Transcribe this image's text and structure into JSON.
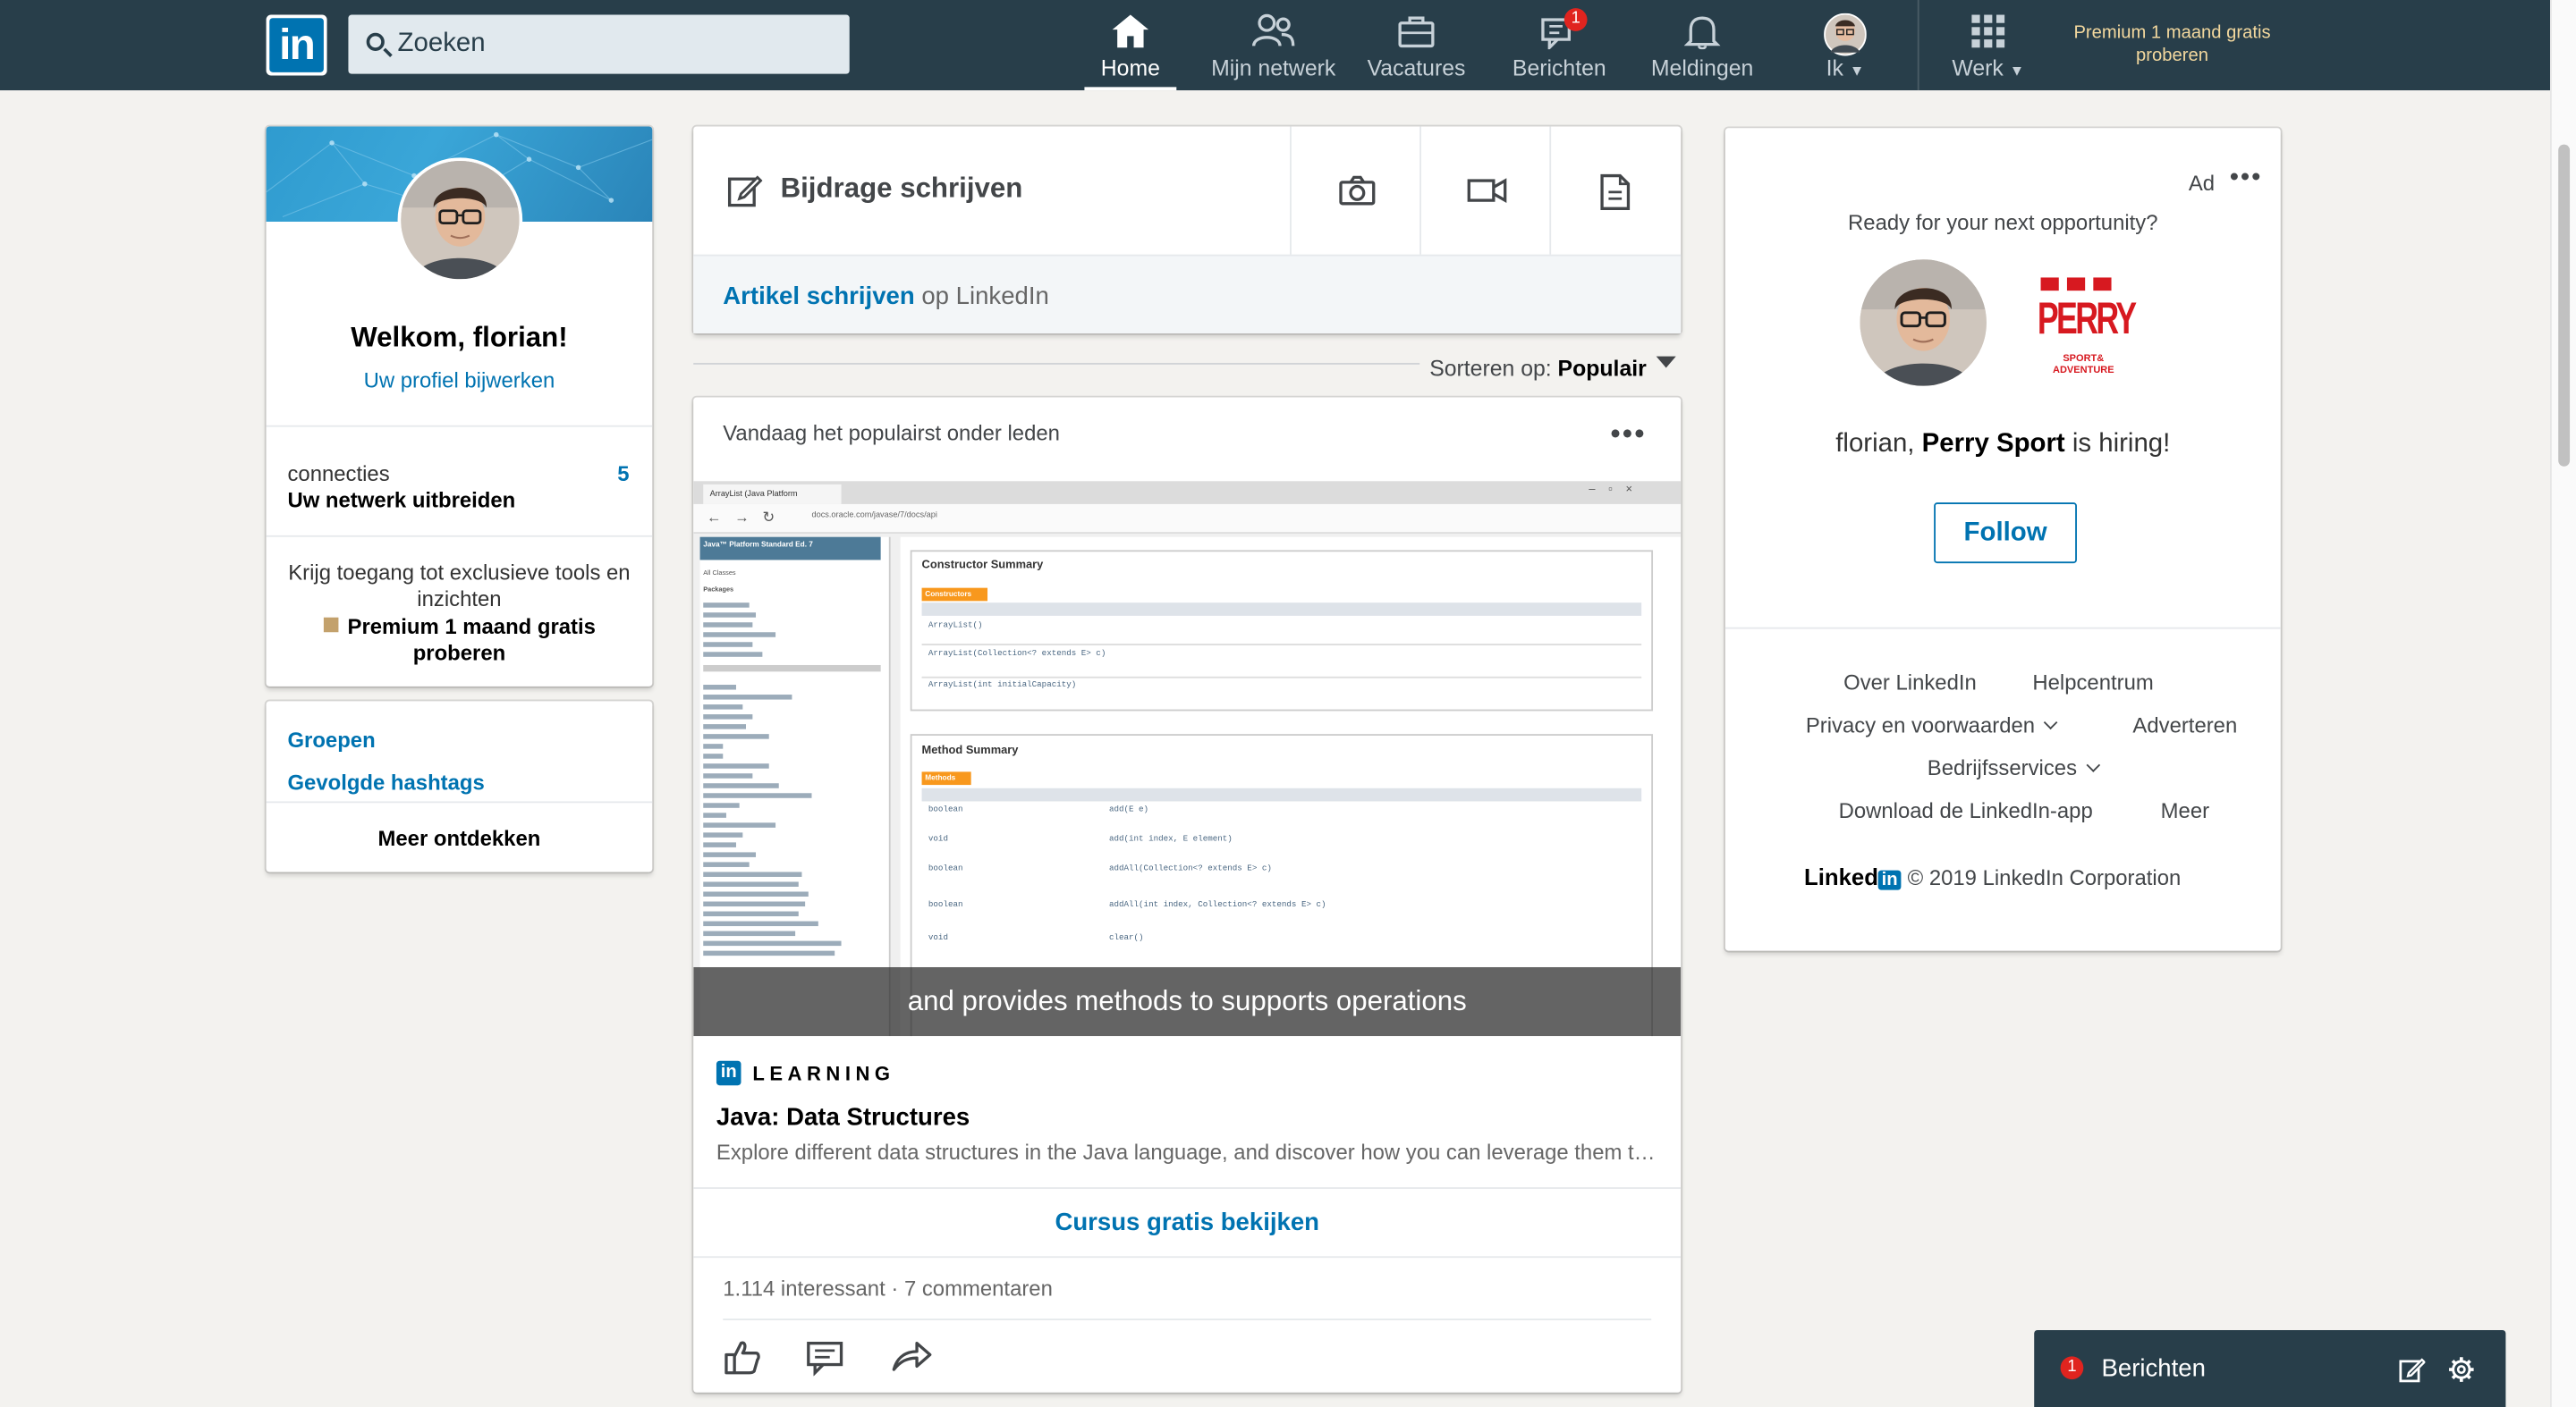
{
  "header": {
    "logo_text": "in",
    "search_placeholder": "Zoeken",
    "nav": [
      {
        "label": "Home",
        "icon": "home-icon"
      },
      {
        "label": "Mijn netwerk",
        "icon": "people-icon"
      },
      {
        "label": "Vacatures",
        "icon": "briefcase-icon"
      },
      {
        "label": "Berichten",
        "icon": "messages-icon",
        "badge": "1"
      },
      {
        "label": "Meldingen",
        "icon": "bell-icon"
      },
      {
        "label": "Ik",
        "icon": "avatar"
      },
      {
        "label": "Werk",
        "icon": "grid-icon"
      }
    ],
    "premium_cta": "Premium 1 maand gratis proberen"
  },
  "profile": {
    "welcome": "Welkom, florian!",
    "update_link": "Uw profiel bijwerken",
    "connections_label": "connecties",
    "connections_sub": "Uw netwerk uitbreiden",
    "connections_count": "5",
    "premium_text": "Krijg toegang tot exclusieve tools en inzichten",
    "premium_cta": "Premium 1 maand gratis proberen"
  },
  "side_links": {
    "groups": "Groepen",
    "hashtags": "Gevolgde hashtags",
    "discover": "Meer ontdekken"
  },
  "share": {
    "write": "Bijdrage schrijven",
    "article_link": "Artikel schrijven",
    "article_suffix": " op LinkedIn"
  },
  "sort": {
    "label": "Sorteren op: ",
    "value": "Populair"
  },
  "feed": {
    "header": "Vandaag het populairst onder leden",
    "video": {
      "tab_title": "ArrayList (Java Platform",
      "url": "docs.oracle.com/javase/7/docs/api",
      "left_head": "Java™ Platform Standard Ed. 7",
      "all_classes": "All Classes",
      "packages": "Packages",
      "constructor_summary": "Constructor Summary",
      "constructors_tag": "Constructors",
      "method_summary": "Method Summary",
      "methods_tag": "Methods",
      "caption": "and provides methods to supports operations"
    },
    "learning_label": "LEARNING",
    "course_title": "Java: Data Structures",
    "course_desc": "Explore different data structures in the Java language, and discover how you can leverage them to write better code.",
    "course_cta": "Cursus gratis bekijken",
    "social_counts": "1.114 interessant · 7 commentaren"
  },
  "ad": {
    "label": "Ad",
    "question": "Ready for your next opportunity?",
    "company_logo_text": "PERRY",
    "company_logo_sub": "SPORT& ADVENTURE",
    "hiring_prefix": "florian, ",
    "hiring_company": "Perry Sport",
    "hiring_suffix": " is hiring!",
    "follow": "Follow"
  },
  "footer": {
    "links": [
      "Over LinkedIn",
      "Helpcentrum",
      "Privacy en voorwaarden",
      "Adverteren",
      "Bedrijfsservices",
      "Download de LinkedIn-app",
      "Meer"
    ],
    "brand_word": "Linked",
    "brand_box": "in",
    "copyright": "© 2019 LinkedIn Corporation"
  },
  "messaging": {
    "badge": "1",
    "label": "Berichten"
  },
  "colors": {
    "header_bg": "#283e4a",
    "brand_blue": "#0073b1",
    "premium_gold": "#f3d89e",
    "notification_red": "#e0241f",
    "perry_red": "#d71920"
  }
}
